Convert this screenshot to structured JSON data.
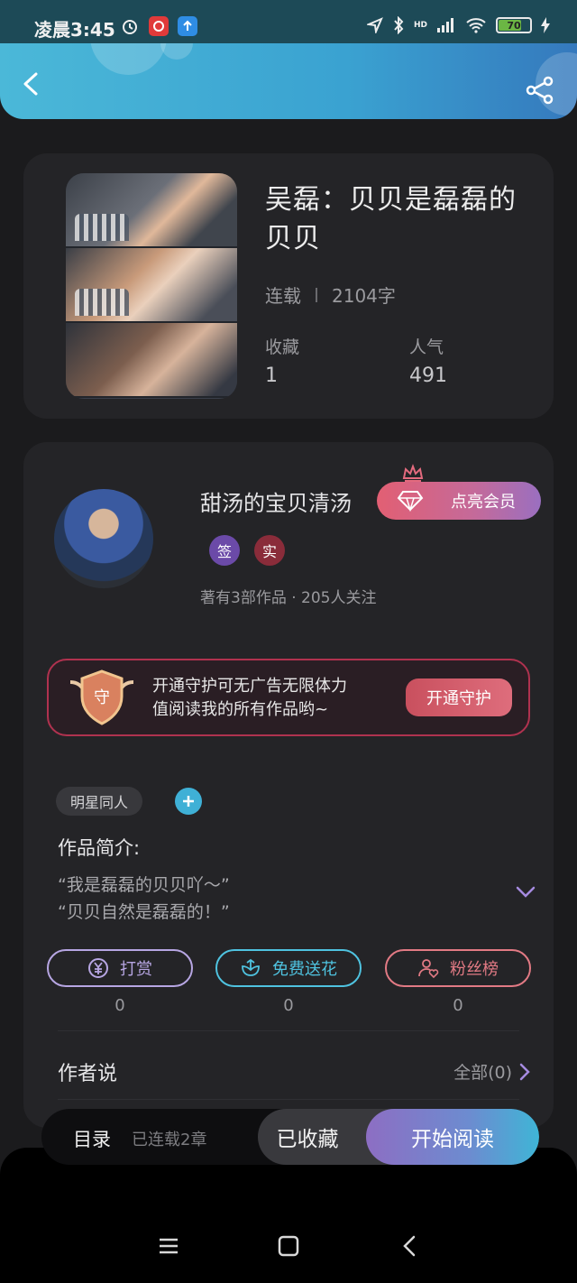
{
  "status_bar": {
    "time": "凌晨3:45",
    "battery": "70",
    "network_label": "HD"
  },
  "book": {
    "title": "吴磊：贝贝是磊磊的贝贝",
    "status": "连载",
    "word_count": "2104字",
    "favorites_label": "收藏",
    "favorites_value": "1",
    "popularity_label": "人气",
    "popularity_value": "491"
  },
  "author": {
    "name": "甜汤的宝贝清汤",
    "vip_button": "点亮会员",
    "badge_sign": "签",
    "badge_real": "实",
    "works_info": "著有3部作品 · 205人关注"
  },
  "guard": {
    "shield_char": "守",
    "line1": "开通守护可无广告无限体力",
    "line2": "值阅读我的所有作品哟~",
    "button": "开通守护"
  },
  "tags": [
    "明星同人"
  ],
  "intro": {
    "title": "作品简介:",
    "line1": "“我是磊磊的贝贝吖～”",
    "line2": "“贝贝自然是磊磊的！”"
  },
  "actions": [
    {
      "label": "打赏",
      "count": "0",
      "color": "#b7a6e3"
    },
    {
      "label": "免费送花",
      "count": "0",
      "color": "#4fc3e0"
    },
    {
      "label": "粉丝榜",
      "count": "0",
      "color": "#e27a84"
    }
  ],
  "author_says": {
    "title": "作者说",
    "all_link": "全部(0)"
  },
  "bottom_bar": {
    "toc": "目录",
    "toc_sub": "已连载2章",
    "favorited": "已收藏",
    "start_reading": "开始阅读"
  },
  "colors": {
    "header_accent": "#3aa2d1",
    "guard_border": "#b0324f"
  }
}
